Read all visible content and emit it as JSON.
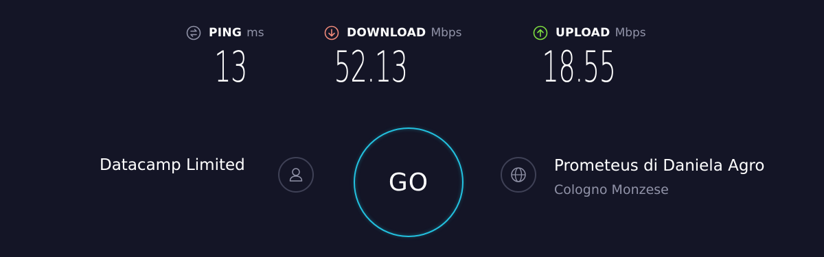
{
  "metrics": {
    "ping": {
      "label": "PING",
      "unit": "ms",
      "value": "13",
      "icon": "ping-icon",
      "icon_color": "#9193a8"
    },
    "download": {
      "label": "DOWNLOAD",
      "unit": "Mbps",
      "value": "52.13",
      "icon": "download-arrow-icon",
      "icon_color": "#f08a7a"
    },
    "upload": {
      "label": "UPLOAD",
      "unit": "Mbps",
      "value": "18.55",
      "icon": "upload-arrow-icon",
      "icon_color": "#7fe040"
    }
  },
  "provider": {
    "name": "Datacamp Limited",
    "icon": "user-icon"
  },
  "go_button": {
    "label": "GO",
    "ring_color": "#23c2e0"
  },
  "server": {
    "name": "Prometeus di Daniela Agro",
    "location": "Cologno Monzese",
    "icon": "globe-icon"
  },
  "colors": {
    "background": "#141526",
    "muted_text": "#9193a8",
    "icon_ring": "#3f4156"
  }
}
